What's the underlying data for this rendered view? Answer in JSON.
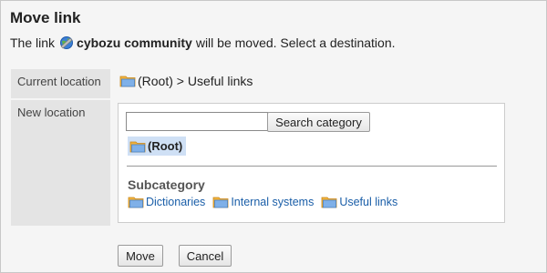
{
  "header": {
    "title": "Move link",
    "desc_prefix": "The link",
    "link_name": "cybozu community",
    "desc_suffix": "will be moved. Select a destination."
  },
  "current": {
    "label": "Current location",
    "path": "(Root) > Useful links"
  },
  "new_location": {
    "label": "New location",
    "search": {
      "value": "",
      "placeholder": ""
    },
    "search_button": "Search category",
    "selected": "(Root)",
    "subcategory_heading": "Subcategory",
    "subcategories": [
      {
        "label": "Dictionaries"
      },
      {
        "label": "Internal systems"
      },
      {
        "label": "Useful links"
      }
    ]
  },
  "actions": {
    "move": "Move",
    "cancel": "Cancel"
  },
  "colors": {
    "label_bg": "#e4e4e4",
    "link": "#1a5ea8",
    "selected_bg": "#cfe0f5"
  }
}
